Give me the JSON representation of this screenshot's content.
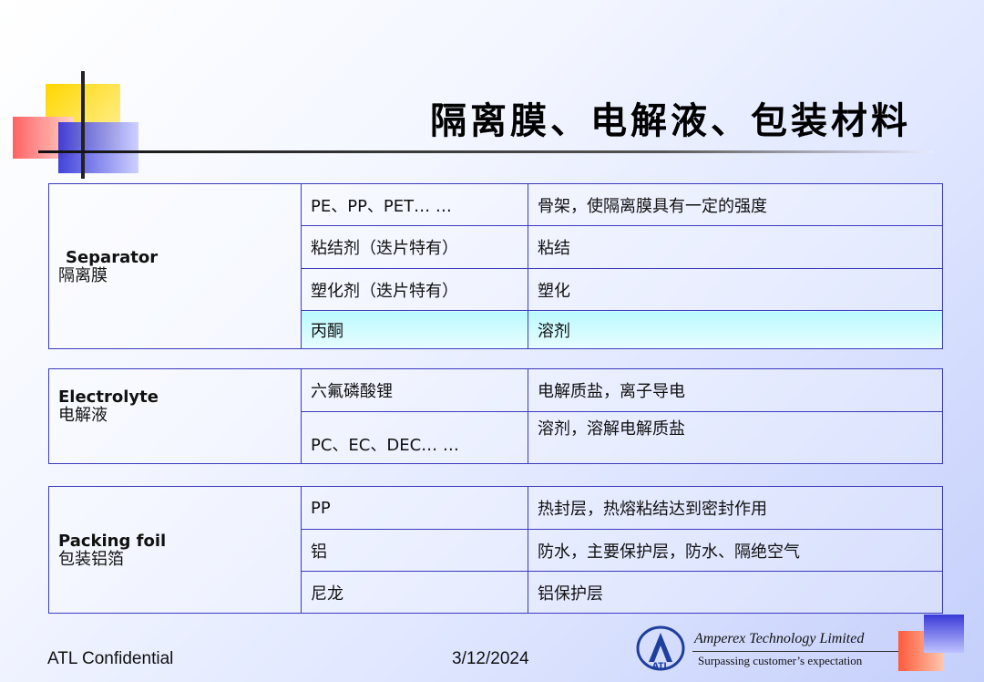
{
  "title": "隔离膜、电解液、包装材料",
  "sections": [
    {
      "label_en": "Separator",
      "label_zh": "隔离膜",
      "rows": [
        {
          "component": "PE、PP、PET… …",
          "function": "骨架，使隔离膜具有一定的强度"
        },
        {
          "component": "粘结剂（迭片特有）",
          "function": "粘结"
        },
        {
          "component": "塑化剂（迭片特有）",
          "function": "塑化"
        },
        {
          "component": "丙酮",
          "function": "溶剂",
          "highlight": true
        }
      ]
    },
    {
      "label_en": "Electrolyte",
      "label_zh": "电解液",
      "rows": [
        {
          "component": "六氟磷酸锂",
          "function": "电解质盐，离子导电"
        },
        {
          "component": "PC、EC、DEC… …",
          "function": "溶剂，溶解电解质盐"
        }
      ]
    },
    {
      "label_en": "Packing foil",
      "label_zh": "包装铝箔",
      "rows": [
        {
          "component": "PP",
          "function": "热封层，热熔粘结达到密封作用"
        },
        {
          "component": "铝",
          "function": "防水，主要保护层，防水、隔绝空气"
        },
        {
          "component": "尼龙",
          "function": "铝保护层"
        }
      ]
    }
  ],
  "footer": {
    "confidential": "ATL Confidential",
    "date": "3/12/2024",
    "company": "Amperex Technology Limited",
    "slogan": "Surpassing customer’s expectation",
    "logo_text": "ATL"
  }
}
